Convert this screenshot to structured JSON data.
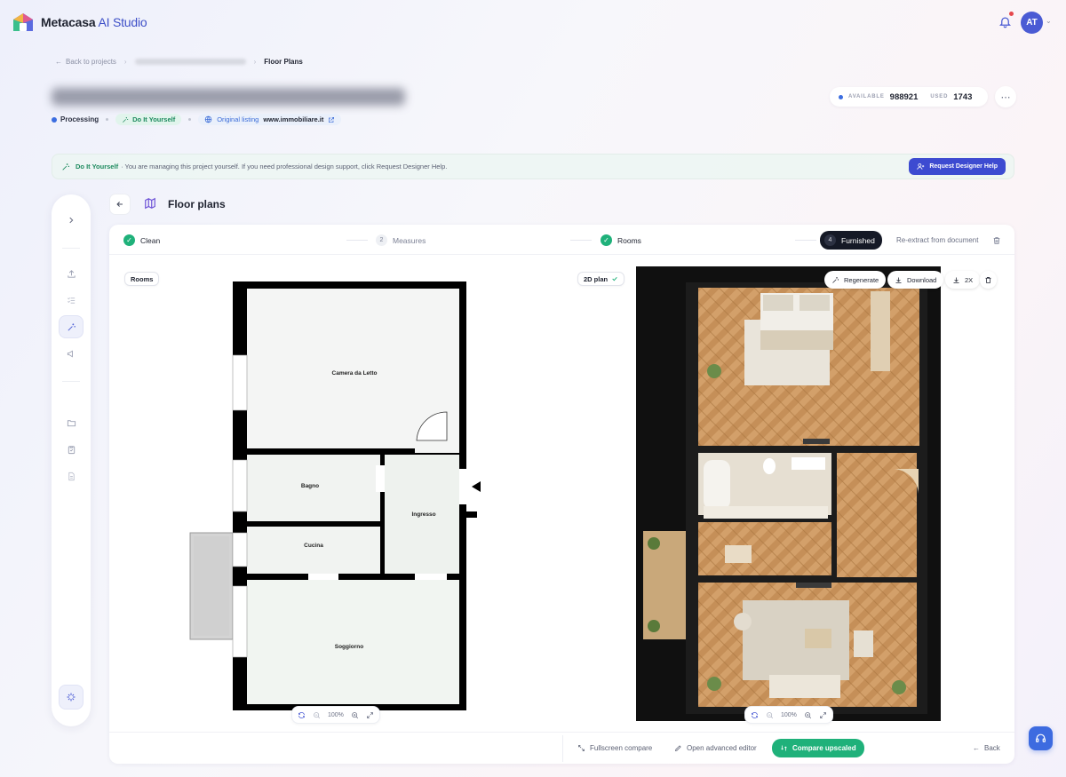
{
  "app": {
    "brand": "Metacasa",
    "brand_suffix": "AI Studio",
    "avatar_initials": "AT"
  },
  "breadcrumb": {
    "back": "Back to projects",
    "current": "Floor Plans"
  },
  "project": {
    "status": "Processing",
    "mode": "Do It Yourself",
    "original_label": "Original listing",
    "original_site": "www.immobiliare.it"
  },
  "credits": {
    "available_label": "AVAILABLE",
    "available": "988921",
    "used_label": "USED",
    "used": "1743"
  },
  "banner": {
    "title": "Do It Yourself",
    "text": "· You are managing this project yourself. If you need professional design support, click Request Designer Help.",
    "button": "Request Designer Help"
  },
  "page": {
    "title": "Floor plans"
  },
  "steps": [
    {
      "label": "Clean",
      "state": "done"
    },
    {
      "label": "Measures",
      "number": "2",
      "state": "todo"
    },
    {
      "label": "Rooms",
      "state": "done"
    },
    {
      "label": "Furnished",
      "number": "4",
      "state": "current"
    }
  ],
  "reextract": "Re-extract from document",
  "left_pane": {
    "tag": "Rooms",
    "rooms": [
      "Camera da Letto",
      "Bagno",
      "Ingresso",
      "Cucina",
      "Soggiorno"
    ],
    "zoom": "100%"
  },
  "right_pane": {
    "tag": "2D plan",
    "regenerate": "Regenerate",
    "download": "Download",
    "scale": "2X",
    "zoom": "100%"
  },
  "footer": {
    "fullscreen": "Fullscreen compare",
    "advanced": "Open advanced editor",
    "compare": "Compare upscaled",
    "back": "Back"
  },
  "colors": {
    "accent": "#3d4bd1",
    "success": "#1fb17a",
    "wood": "#c9955e",
    "dark": "#151926"
  }
}
